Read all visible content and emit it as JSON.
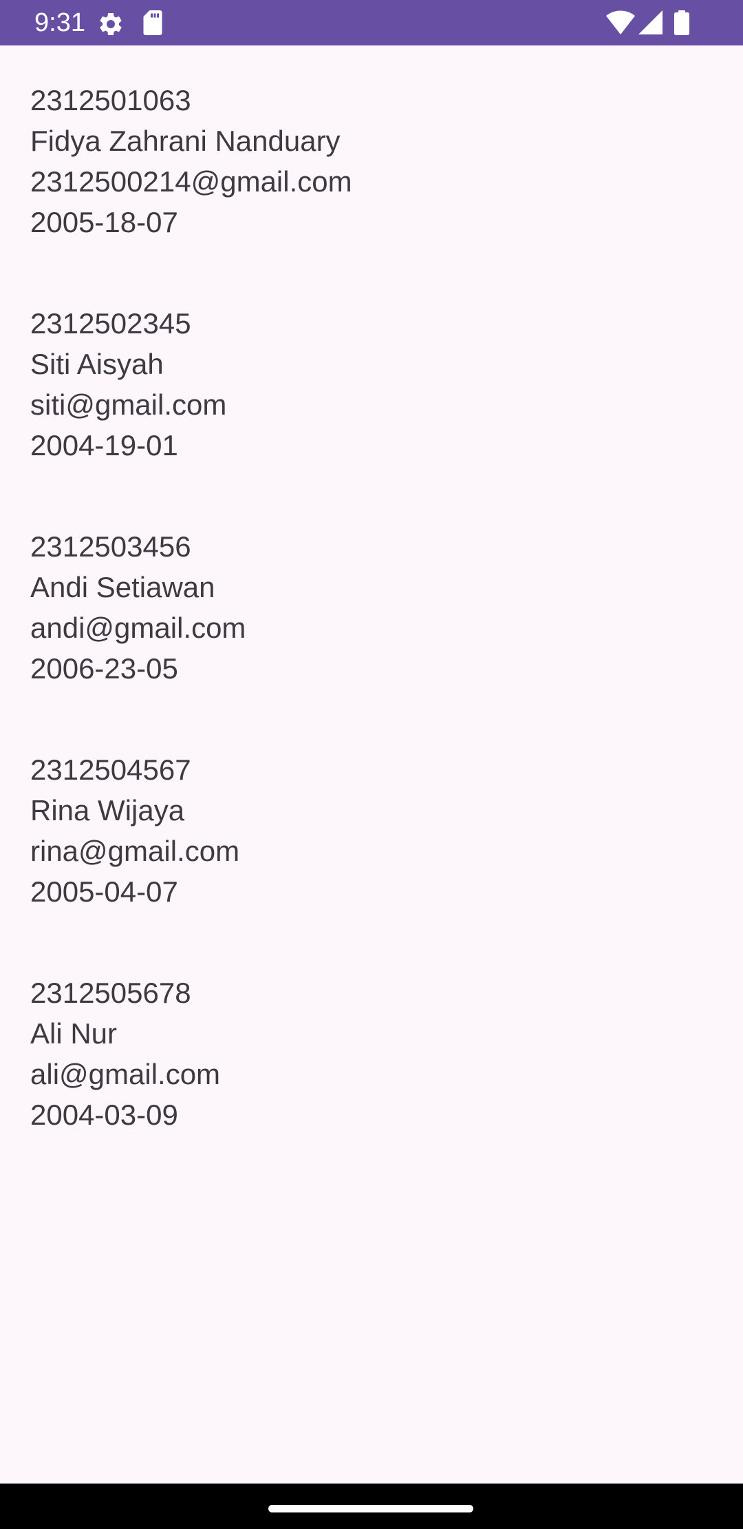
{
  "status_bar": {
    "time": "9:31",
    "icons": [
      "settings-gear-icon",
      "sd-card-icon",
      "wifi-icon",
      "cell-signal-icon",
      "battery-icon"
    ],
    "background": "#6750A4"
  },
  "theme": {
    "background": "#FDF7FC",
    "text_color": "#3E3A40"
  },
  "students": [
    {
      "id": "2312501063",
      "name": "Fidya Zahrani Nanduary",
      "email": "2312500214@gmail.com",
      "date": "2005-18-07"
    },
    {
      "id": "2312502345",
      "name": "Siti Aisyah",
      "email": "siti@gmail.com",
      "date": "2004-19-01"
    },
    {
      "id": "2312503456",
      "name": "Andi Setiawan",
      "email": "andi@gmail.com",
      "date": "2006-23-05"
    },
    {
      "id": "2312504567",
      "name": "Rina Wijaya",
      "email": "rina@gmail.com",
      "date": "2005-04-07"
    },
    {
      "id": "2312505678",
      "name": "Ali Nur",
      "email": "ali@gmail.com",
      "date": "2004-03-09"
    }
  ]
}
